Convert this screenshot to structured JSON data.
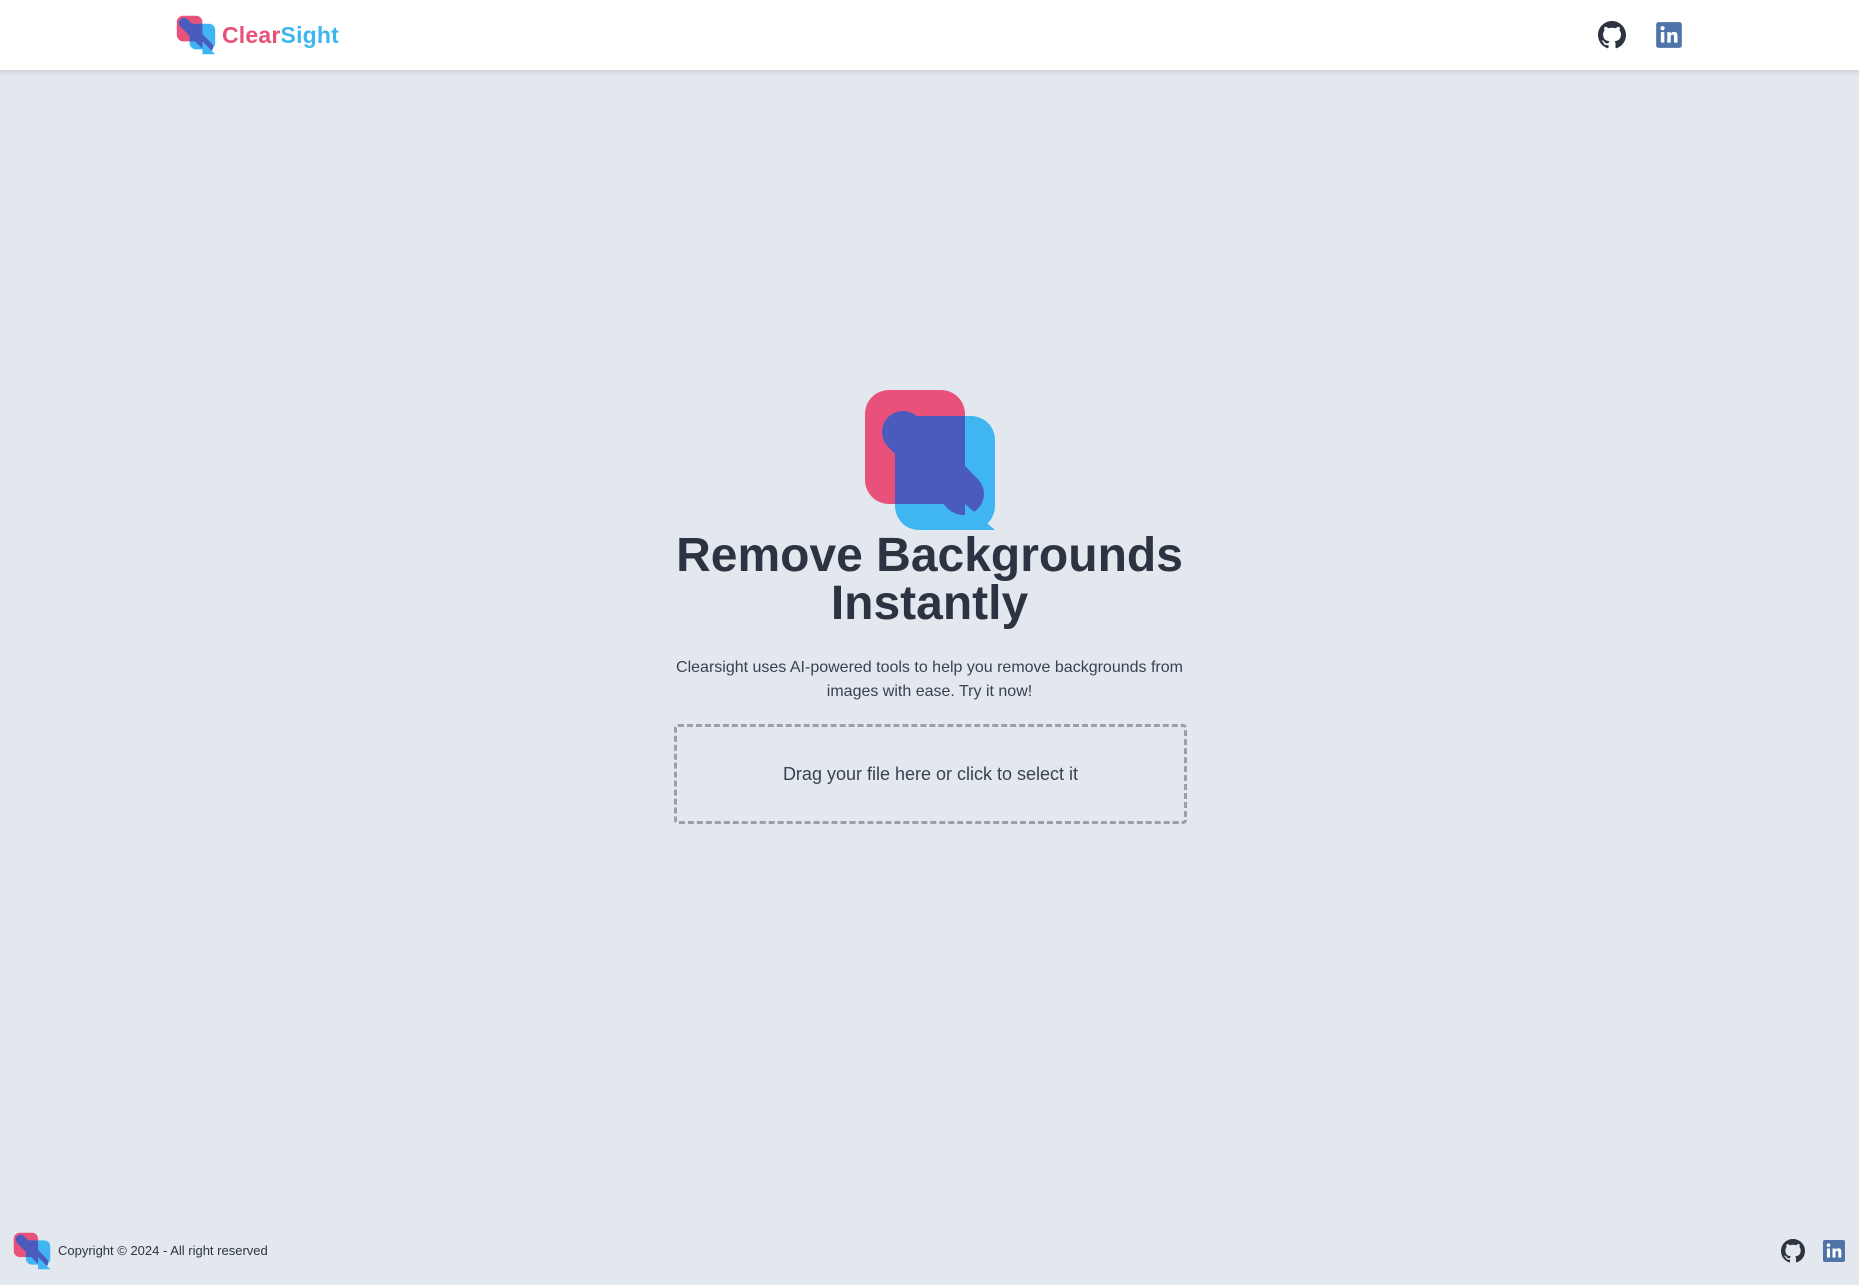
{
  "header": {
    "brand": {
      "part1": "Clear",
      "part2": "Sight"
    },
    "icons": [
      "github-icon",
      "linkedin-icon"
    ]
  },
  "hero": {
    "title": "Remove Backgrounds Instantly",
    "description": "Clearsight uses AI-powered tools to help you remove backgrounds from images with ease. Try it now!",
    "dropzone_label": "Drag your file here or click to select it"
  },
  "footer": {
    "copyright": "Copyright © 2024 - All right reserved",
    "icons": [
      "github-icon",
      "linkedin-icon"
    ]
  },
  "colors": {
    "background": "#e3e8ef",
    "brand_pink": "#e8527a",
    "brand_blue": "#3fb6f1",
    "brand_overlap": "#4a5bbd",
    "text_dark": "#2d3340",
    "linkedin_blue": "#4f74aa"
  }
}
